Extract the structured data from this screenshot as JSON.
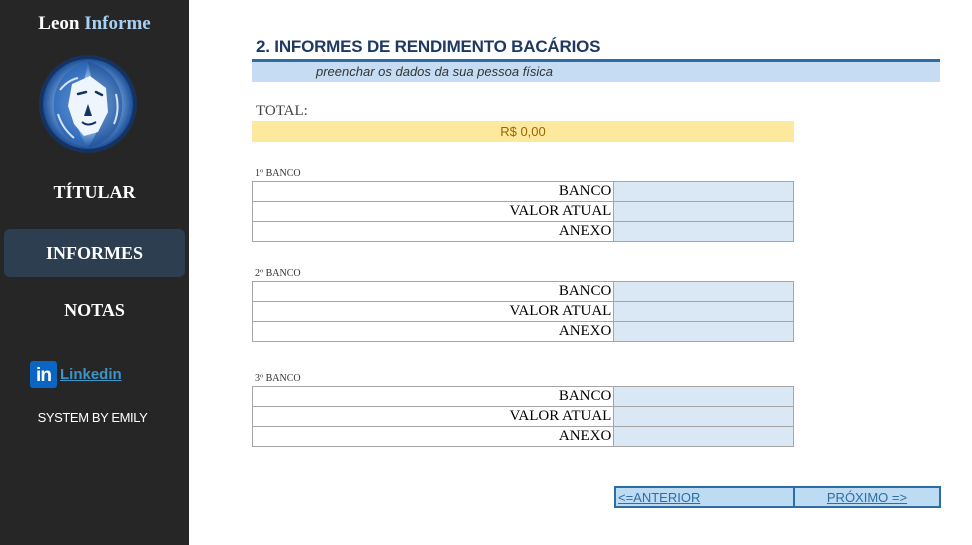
{
  "sidebar": {
    "brand_part1": "Leon",
    "brand_part2": "Informe",
    "items": [
      {
        "label": "TÍTULAR",
        "active": false
      },
      {
        "label": "INFORMES",
        "active": true
      },
      {
        "label": "NOTAS",
        "active": false
      }
    ],
    "linkedin_icon_text": "in",
    "linkedin_label": "Linkedin",
    "system_label": "SYSTEM BY EMILY"
  },
  "main": {
    "title": "2. INFORMES DE RENDIMENTO BACÁRIOS",
    "subtitle": "preenchar os dados da sua pessoa física",
    "total_label": "TOTAL:",
    "total_value": "R$ 0,00",
    "banks": [
      {
        "caption": "1º BANCO",
        "rows": [
          {
            "label": "BANCO",
            "value": ""
          },
          {
            "label": "VALOR ATUAL",
            "value": ""
          },
          {
            "label": "ANEXO",
            "value": ""
          }
        ]
      },
      {
        "caption": "2º BANCO",
        "rows": [
          {
            "label": "BANCO",
            "value": ""
          },
          {
            "label": "VALOR ATUAL",
            "value": ""
          },
          {
            "label": "ANEXO",
            "value": ""
          }
        ]
      },
      {
        "caption": "3º BANCO",
        "rows": [
          {
            "label": "BANCO",
            "value": ""
          },
          {
            "label": "VALOR ATUAL",
            "value": ""
          },
          {
            "label": "ANEXO",
            "value": ""
          }
        ]
      }
    ],
    "prev_label": "<=ANTERIOR",
    "next_label": "PRÓXIMO =>"
  },
  "colors": {
    "sidebar_bg": "#262626",
    "active_item_bg": "#2c3e50",
    "accent_blue": "#2e6da4",
    "input_fill": "#dae8f6",
    "total_fill": "#fde99d"
  },
  "icons": {
    "logo": "lion-head-logo",
    "linkedin": "linkedin-icon"
  }
}
